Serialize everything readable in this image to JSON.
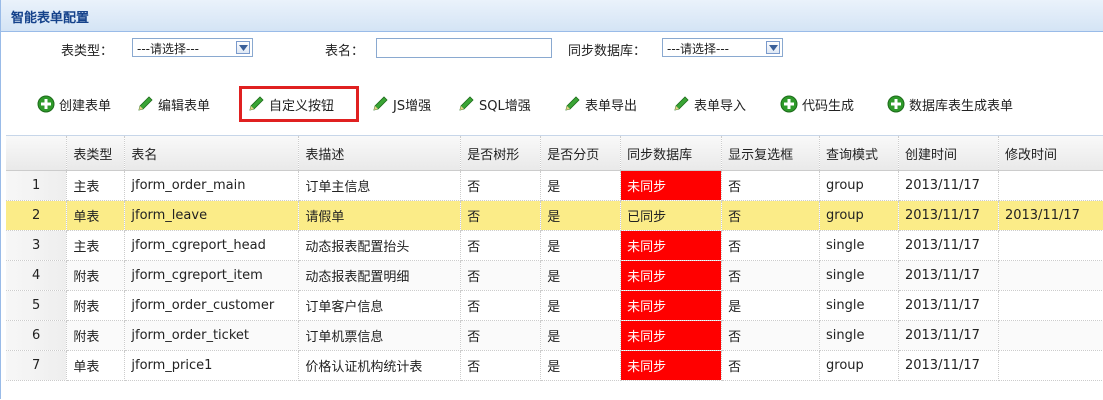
{
  "panel": {
    "title": "智能表单配置"
  },
  "search": {
    "table_type_label": "表类型：",
    "table_type_value": "---请选择---",
    "table_name_label": "表名：",
    "table_name_value": "",
    "sync_db_label": "同步数据库：",
    "sync_db_value": "---请选择---"
  },
  "toolbar": {
    "create": "创建表单",
    "edit": "编辑表单",
    "custom_button": "自定义按钮",
    "js_enhance": "JS增强",
    "sql_enhance": "SQL增强",
    "export": "表单导出",
    "import": "表单导入",
    "codegen": "代码生成",
    "db_to_form": "数据库表生成表单"
  },
  "grid": {
    "headers": [
      "",
      "表类型",
      "表名",
      "表描述",
      "是否树形",
      "是否分页",
      "同步数据库",
      "显示复选框",
      "查询模式",
      "创建时间",
      "修改时间"
    ],
    "rows": [
      [
        "1",
        "主表",
        "jform_order_main",
        "订单主信息",
        "否",
        "是",
        "未同步",
        "否",
        "group",
        "2013/11/17",
        ""
      ],
      [
        "2",
        "单表",
        "jform_leave",
        "请假单",
        "否",
        "是",
        "已同步",
        "否",
        "group",
        "2013/11/17",
        "2013/11/17"
      ],
      [
        "3",
        "主表",
        "jform_cgreport_head",
        "动态报表配置抬头",
        "否",
        "是",
        "未同步",
        "否",
        "single",
        "2013/11/17",
        ""
      ],
      [
        "4",
        "附表",
        "jform_cgreport_item",
        "动态报表配置明细",
        "否",
        "是",
        "未同步",
        "否",
        "single",
        "2013/11/17",
        ""
      ],
      [
        "5",
        "附表",
        "jform_order_customer",
        "订单客户信息",
        "否",
        "是",
        "未同步",
        "是",
        "single",
        "2013/11/17",
        ""
      ],
      [
        "6",
        "附表",
        "jform_order_ticket",
        "订单机票信息",
        "否",
        "是",
        "未同步",
        "否",
        "single",
        "2013/11/17",
        ""
      ],
      [
        "7",
        "单表",
        "jform_price1",
        "价格认证机构统计表",
        "否",
        "是",
        "未同步",
        "否",
        "group",
        "2013/11/17",
        ""
      ]
    ],
    "selected_row": 2
  },
  "colors": {
    "not_synced": "#ff0000",
    "selected_row": "#fbec88",
    "header_title": "#15428b"
  },
  "icons": {
    "add": "plus-circle-green-icon",
    "edit": "pencil-green-icon"
  }
}
